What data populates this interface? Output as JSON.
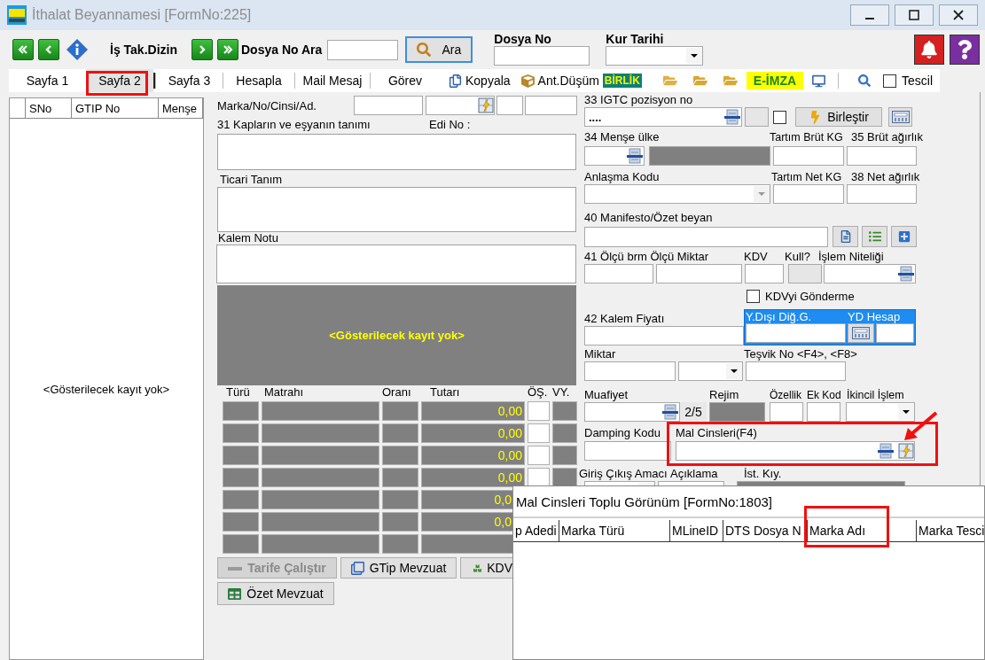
{
  "window": {
    "title": "İthalat Beyannamesi [FormNo:225]"
  },
  "toolbar": {
    "tracking_label": "İş Tak.Dizin",
    "search_label": "Dosya No Ara",
    "search_button": "Ara",
    "file_no_label": "Dosya No",
    "rate_date_label": "Kur Tarihi"
  },
  "tabs": [
    {
      "label": "Sayfa 1",
      "selected": false
    },
    {
      "label": "Sayfa 2",
      "selected": true
    },
    {
      "label": "Sayfa 3",
      "selected": false
    },
    {
      "label": "Hesapla",
      "selected": false
    },
    {
      "label": "Mail Mesaj",
      "selected": false
    },
    {
      "label": "Görev",
      "selected": false
    }
  ],
  "action_bar": {
    "copy": "Kopyala",
    "deduction": "Ant.Düşüm",
    "union_badge": "BİRLİK",
    "esign_badge": "E-İMZA",
    "registered": {
      "label": "Tescil",
      "checked": false
    }
  },
  "item_list": {
    "columns": [
      "SNo",
      "GTIP No",
      "Menşe"
    ],
    "empty_text": "<Gösterilecek kayıt yok>"
  },
  "item_form": {
    "marks_label": "Marka/No/Cinsi/Ad.",
    "description_label": "31 Kapların ve eşyanın tanımı",
    "edi_label": "Edi No :",
    "trade_label": "Ticari Tanım",
    "note_label": "Kalem Notu",
    "empty_text": "<Gösterilecek kayıt yok>"
  },
  "tax_table": {
    "columns": [
      "Türü",
      "Matrahı",
      "Oranı",
      "Tutarı",
      "ÖŞ.",
      "VY."
    ],
    "rows": [
      {
        "kind": "full",
        "amount": "0,00"
      },
      {
        "kind": "full",
        "amount": "0,00"
      },
      {
        "kind": "full",
        "amount": "0,00"
      },
      {
        "kind": "full",
        "amount": "0,00"
      },
      {
        "kind": "cut",
        "amount": "0,0"
      },
      {
        "kind": "cut",
        "amount": "0,0"
      },
      {
        "kind": "cut"
      }
    ]
  },
  "buttons": [
    {
      "label": "Tarife Çalıştır",
      "disabled": true
    },
    {
      "label": "GTip Mevzuat",
      "disabled": false
    },
    {
      "label": "KDV",
      "disabled": false
    },
    {
      "label": "Özet Mevzuat",
      "disabled": false
    }
  ],
  "declaration": {
    "gtc_label": "33 IGTC pozisyon no",
    "gtc_value": "....",
    "gtc_merge": {
      "checked": false
    },
    "merge_button": "Birleştir",
    "origin_label": "34 Menşe ülke",
    "gross_tare_label": "Tartım Brüt KG",
    "gross_label": "35 Brüt ağırlık",
    "agreement_label": "Anlaşma Kodu",
    "net_tare_label": "Tartım Net KG",
    "net_label": "38 Net ağırlık",
    "manifest_label": "40 Manifesto/Özet beyan",
    "unit_label": "41 Ölçü brm Ölçü Miktar",
    "vat_label": "KDV",
    "used_label": "Kull?",
    "operation_label": "İşlem Niteliği",
    "vat_skip": {
      "label": "KDVyi Gönderme",
      "checked": false
    },
    "price_label": "42 Kalem Fiyatı",
    "foreign_cost_label": "Y.Dışı Diğ.G.",
    "foreign_account_label": "YD Hesap",
    "quantity_label": "Miktar",
    "incentive_label": "Teşvik No <F4>, <F8>",
    "exemption_label": "Muafiyet",
    "exemption_count": "2/5",
    "regime_label": "Rejim",
    "feature_label": "Özellik",
    "extra_code_label": "Ek Kod",
    "secondary_label": "İkincil İşlem",
    "dumping_label": "Damping Kodu",
    "goods_label": "Mal Cinsleri(F4)",
    "purpose_label": "Giriş Çıkış Amacı",
    "explanation_label": "Açıklama",
    "stat_label": "İst. Kıy."
  },
  "dialog": {
    "title": "Mal Cinsleri Toplu Görünüm [FormNo:1803]",
    "columns": [
      "p Adedi",
      "Marka Türü",
      "MLineID",
      "DTS Dosya N",
      "Marka Adı",
      "Marka Tesci"
    ]
  }
}
